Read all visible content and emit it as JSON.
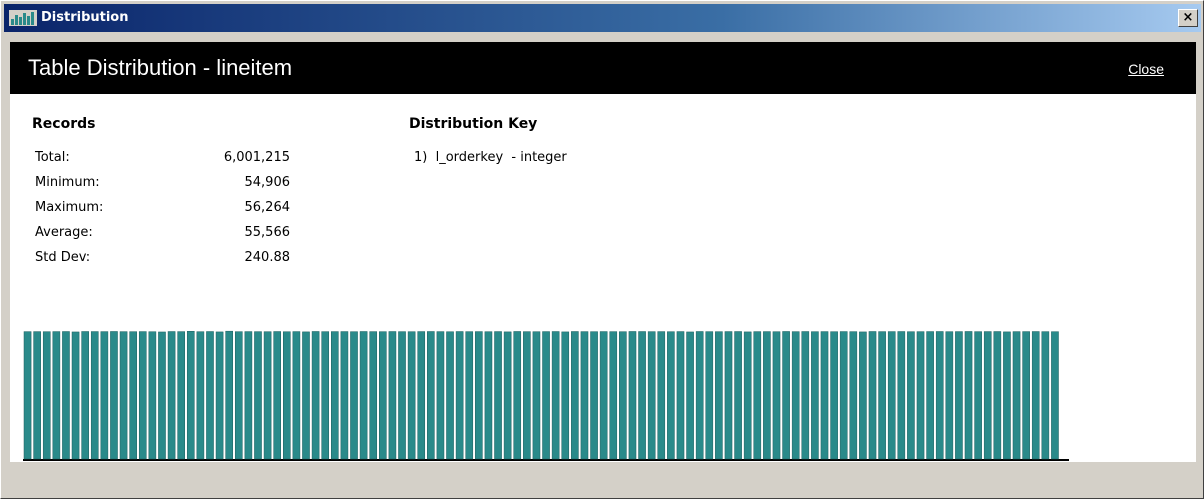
{
  "window": {
    "title": "Distribution",
    "close_glyph": "×",
    "icon": "bar-chart-icon"
  },
  "header": {
    "title": "Table Distribution - lineitem",
    "close_label": "Close"
  },
  "records": {
    "title": "Records",
    "rows": [
      {
        "label": "Total:",
        "value": "6,001,215"
      },
      {
        "label": "Minimum:",
        "value": "54,906"
      },
      {
        "label": "Maximum:",
        "value": "56,264"
      },
      {
        "label": "Average:",
        "value": "55,566"
      },
      {
        "label": "Std Dev:",
        "value": "240.88"
      }
    ]
  },
  "distribution_key": {
    "title": "Distribution Key",
    "items": [
      "1)  l_orderkey  - integer"
    ]
  },
  "colors": {
    "bar": "#2a8a8a",
    "bar_border": "#1e5f5f",
    "header_bg": "#000000",
    "content_bg": "#ffffff"
  },
  "chart_data": {
    "type": "bar",
    "title": "",
    "xlabel": "",
    "ylabel": "",
    "ylim": [
      0,
      56264
    ],
    "values": [
      55560,
      55570,
      55540,
      55580,
      55600,
      55420,
      55610,
      55590,
      55570,
      55620,
      55560,
      55550,
      55580,
      55530,
      55410,
      55600,
      55570,
      55710,
      55540,
      55600,
      55430,
      55750,
      55550,
      55580,
      55560,
      55540,
      55600,
      55520,
      55580,
      55450,
      55620,
      55560,
      55580,
      55590,
      55540,
      55610,
      55570,
      55550,
      55600,
      55560,
      55540,
      55590,
      55610,
      55570,
      55520,
      55600,
      55560,
      55580,
      55540,
      55590,
      55450,
      55620,
      55560,
      55540,
      55580,
      55600,
      55440,
      55610,
      55570,
      55550,
      55590,
      55560,
      55540,
      55620,
      55600,
      55560,
      55580,
      55540,
      55590,
      55420,
      55610,
      55560,
      55550,
      55590,
      55600,
      55440,
      55570,
      55580,
      55540,
      55620,
      55560,
      55600,
      55550,
      55580,
      55540,
      55590,
      55560,
      55430,
      55610,
      55570,
      55580,
      55600,
      55540,
      55560,
      55590,
      55610,
      55550,
      55580,
      55620,
      55560,
      55590,
      55600,
      55450,
      55570,
      55580,
      55600,
      55560,
      55540
    ]
  }
}
